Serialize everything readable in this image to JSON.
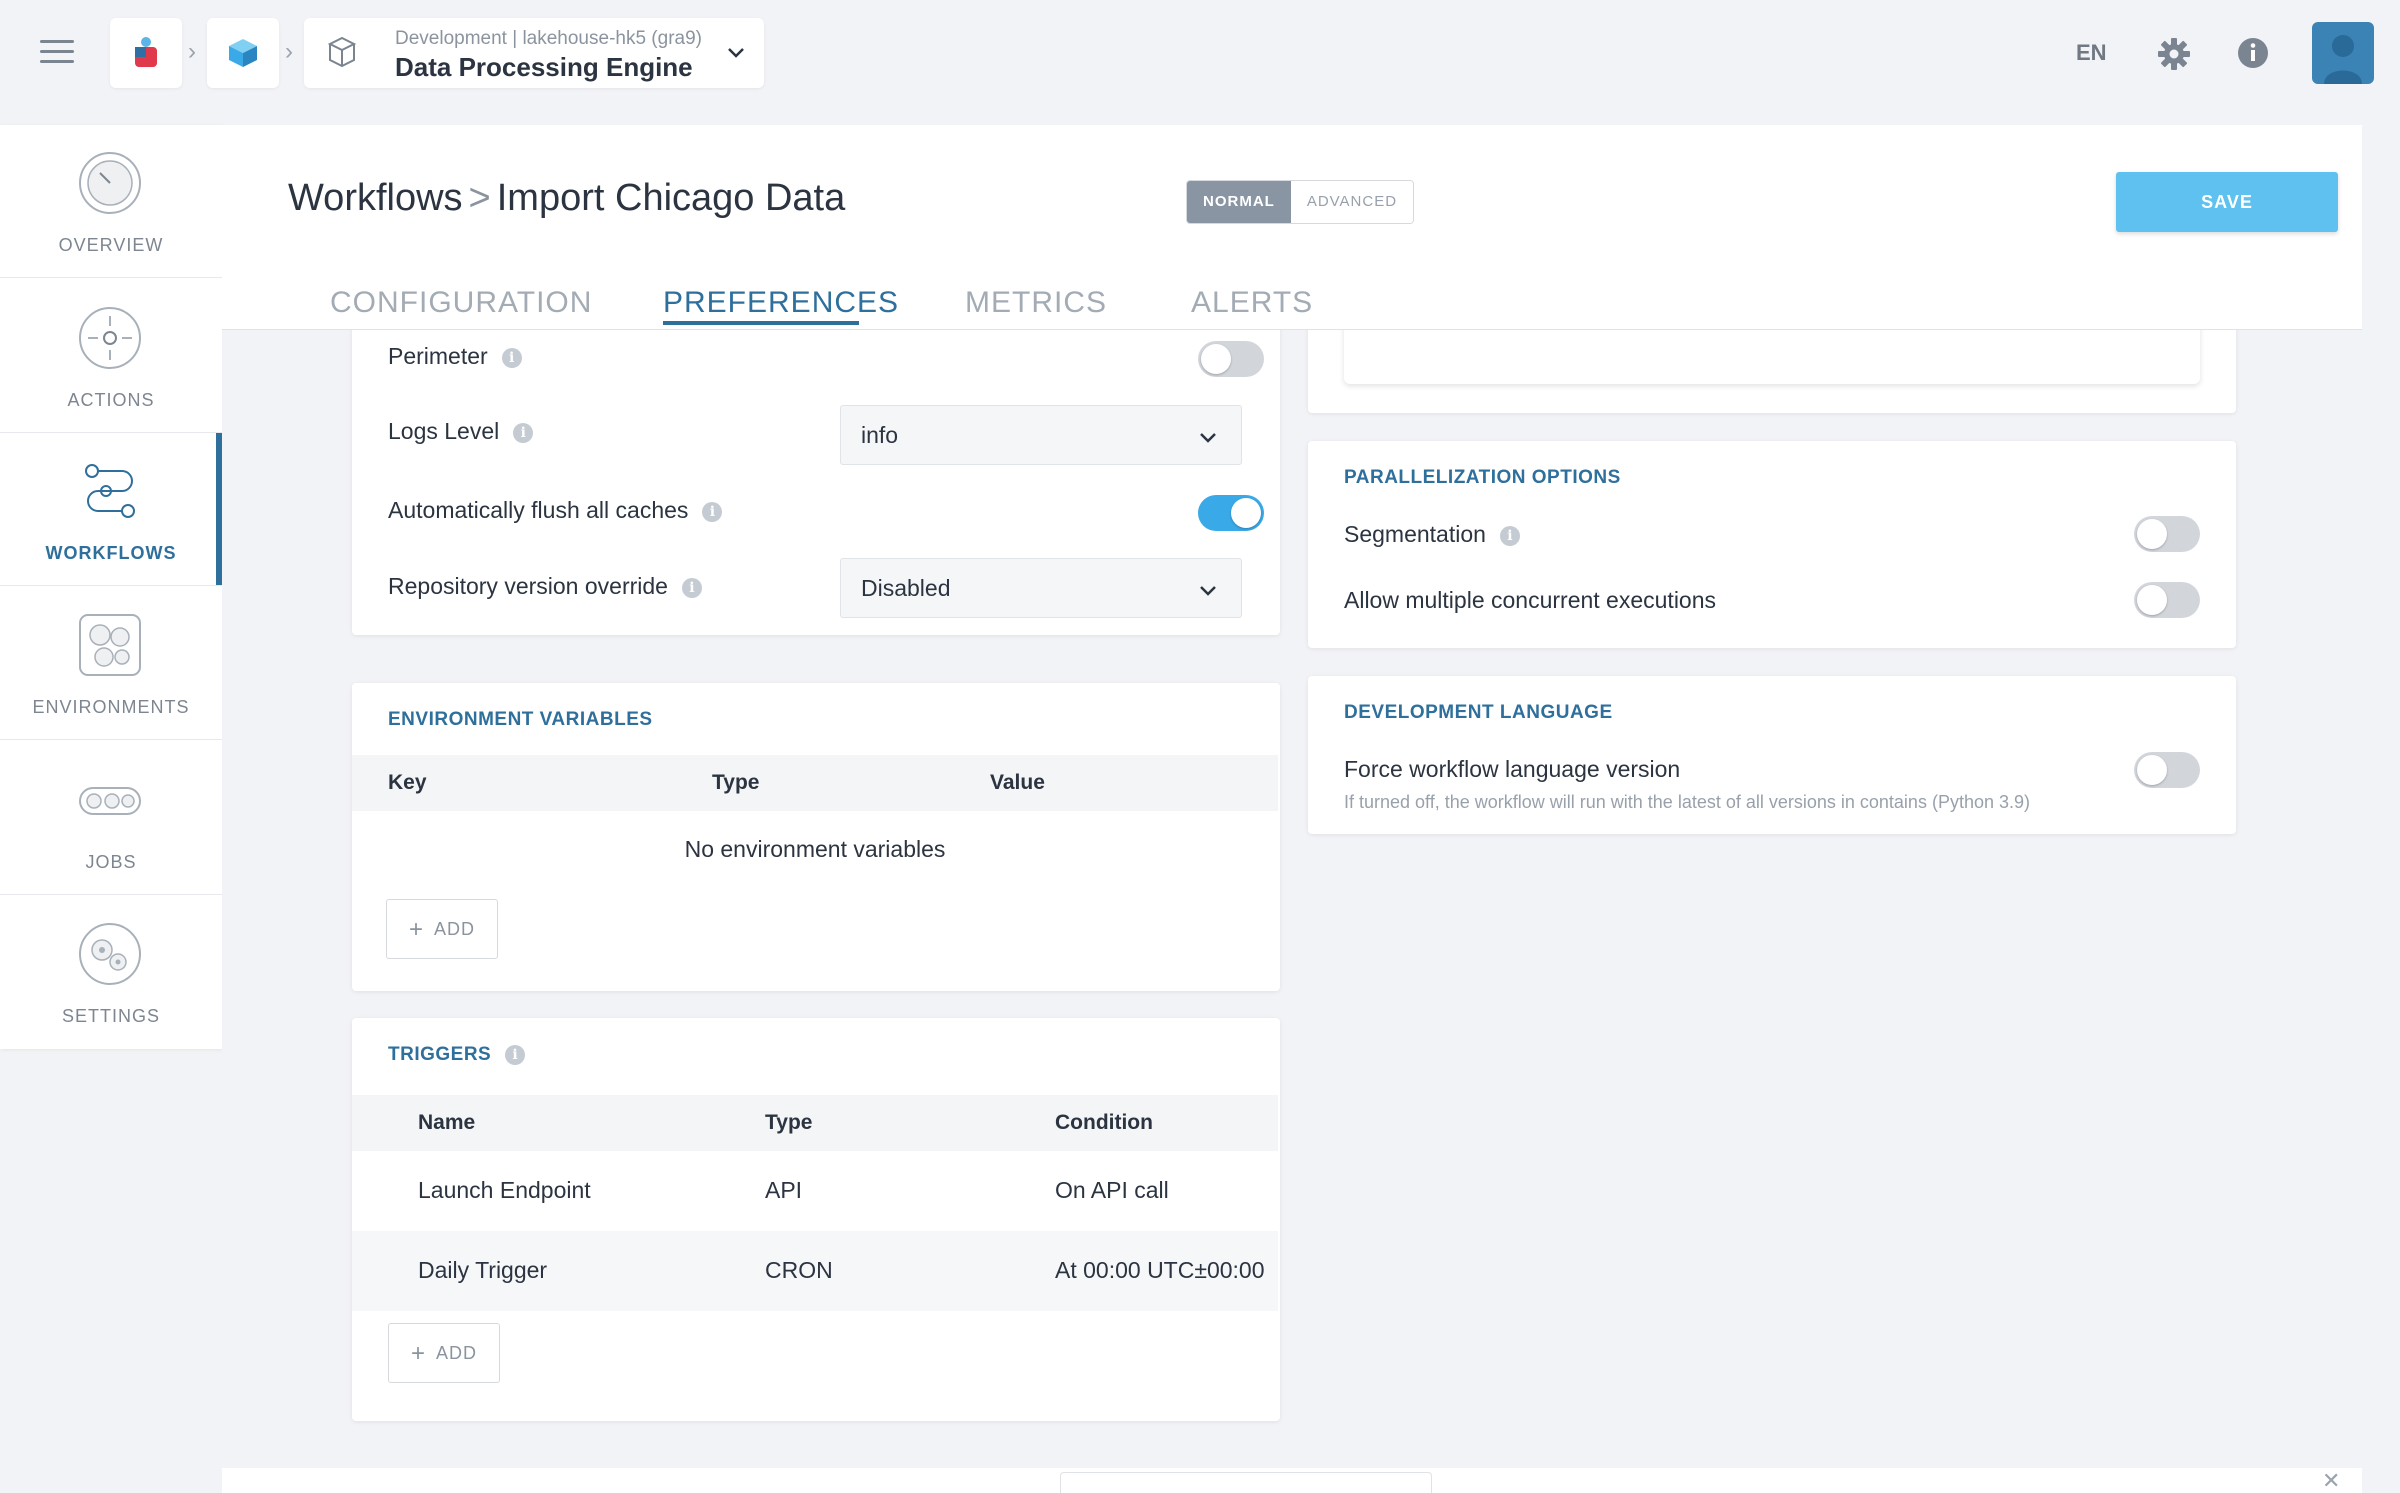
{
  "header": {
    "env_subtitle": "Development | lakehouse-hk5 (gra9)",
    "env_title": "Data Processing Engine",
    "language": "EN"
  },
  "sidebar": {
    "items": [
      {
        "label": "OVERVIEW"
      },
      {
        "label": "ACTIONS"
      },
      {
        "label": "WORKFLOWS"
      },
      {
        "label": "ENVIRONMENTS"
      },
      {
        "label": "JOBS"
      },
      {
        "label": "SETTINGS"
      }
    ]
  },
  "page": {
    "breadcrumb_root": "Workflows",
    "breadcrumb_sep": ">",
    "breadcrumb_current": "Import Chicago Data",
    "mode_normal": "NORMAL",
    "mode_advanced": "ADVANCED",
    "save_label": "SAVE",
    "tabs": [
      {
        "label": "CONFIGURATION"
      },
      {
        "label": "PREFERENCES"
      },
      {
        "label": "METRICS"
      },
      {
        "label": "ALERTS"
      }
    ],
    "active_tab": "PREFERENCES"
  },
  "general": {
    "perimeter_label": "Perimeter",
    "perimeter_on": false,
    "logs_level_label": "Logs Level",
    "logs_level_value": "info",
    "flush_caches_label": "Automatically flush all caches",
    "flush_caches_on": true,
    "repo_override_label": "Repository version override",
    "repo_override_value": "Disabled"
  },
  "env_vars": {
    "title": "ENVIRONMENT VARIABLES",
    "columns": [
      "Key",
      "Type",
      "Value"
    ],
    "empty_text": "No environment variables",
    "add_label": "ADD"
  },
  "triggers": {
    "title": "TRIGGERS",
    "columns": [
      "Name",
      "Type",
      "Condition"
    ],
    "rows": [
      {
        "name": "Launch Endpoint",
        "type": "API",
        "condition": "On API call"
      },
      {
        "name": "Daily Trigger",
        "type": "CRON",
        "condition": "At 00:00 UTC±00:00"
      }
    ],
    "add_label": "ADD"
  },
  "parallelization": {
    "title": "PARALLELIZATION OPTIONS",
    "segmentation_label": "Segmentation",
    "segmentation_on": false,
    "concurrent_label": "Allow multiple concurrent executions",
    "concurrent_on": false
  },
  "dev_language": {
    "title": "DEVELOPMENT LANGUAGE",
    "force_label": "Force workflow language version",
    "force_help": "If turned off, the workflow will run with the latest of all versions in contains (Python 3.9)",
    "force_on": false
  },
  "colors": {
    "accent": "#2e6f9c",
    "toggle_on": "#3aa9e8",
    "save_button": "#5ec1ef"
  },
  "info_glyph": "i"
}
